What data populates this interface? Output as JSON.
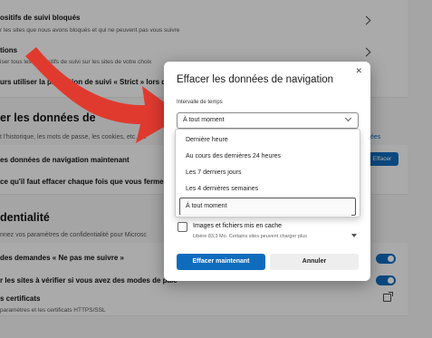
{
  "background": {
    "rows": [
      {
        "title": "ositifs de suivi bloqués",
        "subtitle": "r les sites que nous avons bloqués et qui ne peuvent pas vous suivre"
      },
      {
        "title": "tions",
        "subtitle": "iser tous les dispositifs de suivi sur les sites de votre choix"
      },
      {
        "title": "urs utiliser la protection de suivi « Strict » lors de Ne",
        "subtitle": ""
      }
    ],
    "section_clear": {
      "heading": "er les données de",
      "desc": "t l'historique, les mots de passe, les cookies, etc. Se",
      "link": "ées",
      "row1": "es données de navigation maintenant",
      "row1_button": "Effacer",
      "row2": "ce qu'il faut effacer chaque fois que vous fermez le"
    },
    "section_privacy": {
      "heading": "dentialité",
      "desc": "nnez vos paramètres de confidentialité pour Microsc",
      "row1": "des demandes « Ne pas me suivre »",
      "row2": "r les sites à vérifier si vous avez des modes de paie",
      "row3_title": "s certificats",
      "row3_subtitle": "paramètres et les certificats HTTPS/SSL"
    }
  },
  "dialog": {
    "title": "Effacer les données de navigation",
    "close_icon": "close-icon",
    "time_range_label": "Intervalle de temps",
    "time_range_value": "À tout moment",
    "options": [
      "Dernière heure",
      "Au cours des dernières 24 heures",
      "Les 7 derniers jours",
      "Les 4 dernières semaines",
      "À tout moment"
    ],
    "cache_item": {
      "title": "Images et fichiers mis en cache",
      "subtitle": "Libère 83,3 Mo. Certains sites peuvent charger plus"
    },
    "clear_button": "Effacer maintenant",
    "cancel_button": "Annuler"
  },
  "colors": {
    "accent": "#0f6cbd",
    "arrow": "#e03a2f"
  }
}
